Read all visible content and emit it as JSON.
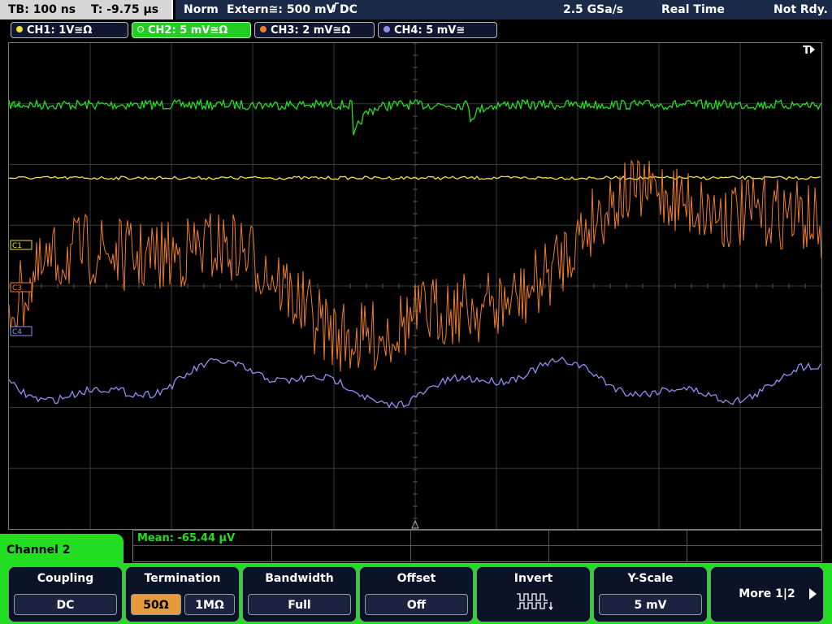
{
  "status": {
    "timebase": "TB: 100 ns",
    "trigger_time": "T: -9.75 µs",
    "mode": "Norm",
    "trigger_source": "Extern≅: 500 mV",
    "trigger_coupling": "DC",
    "sample_rate": "2.5 GSa/s",
    "acq_mode": "Real Time",
    "trigger_status": "Not Rdy."
  },
  "channels": [
    {
      "label": "CH1: 1V≅Ω",
      "color": "#f2e13a"
    },
    {
      "label": "CH2: 5 mV≅Ω",
      "color": "#22dd22"
    },
    {
      "label": "CH3: 2 mV≅Ω",
      "color": "#f07d2b"
    },
    {
      "label": "CH4: 5 mV≅",
      "color": "#8f8ff0"
    }
  ],
  "markers": {
    "trigger": "T",
    "c1": "C1",
    "c2": "C2",
    "c3": "C3",
    "c4": "C4"
  },
  "measurement": {
    "value": "Mean: -65.44 µV"
  },
  "menu": {
    "channel_name": "Channel 2",
    "coupling": {
      "title": "Coupling",
      "value": "DC"
    },
    "termination": {
      "title": "Termination",
      "option1": "50Ω",
      "option2": "1MΩ",
      "selected": "50Ω"
    },
    "bandwidth": {
      "title": "Bandwidth",
      "value": "Full"
    },
    "offset": {
      "title": "Offset",
      "value": "Off"
    },
    "invert": {
      "title": "Invert",
      "icon": "inverted-pulse-icon"
    },
    "yscale": {
      "title": "Y-Scale",
      "value": "5 mV"
    },
    "more": {
      "label": "More 1|2",
      "icon": "arrow-right-icon"
    }
  }
}
